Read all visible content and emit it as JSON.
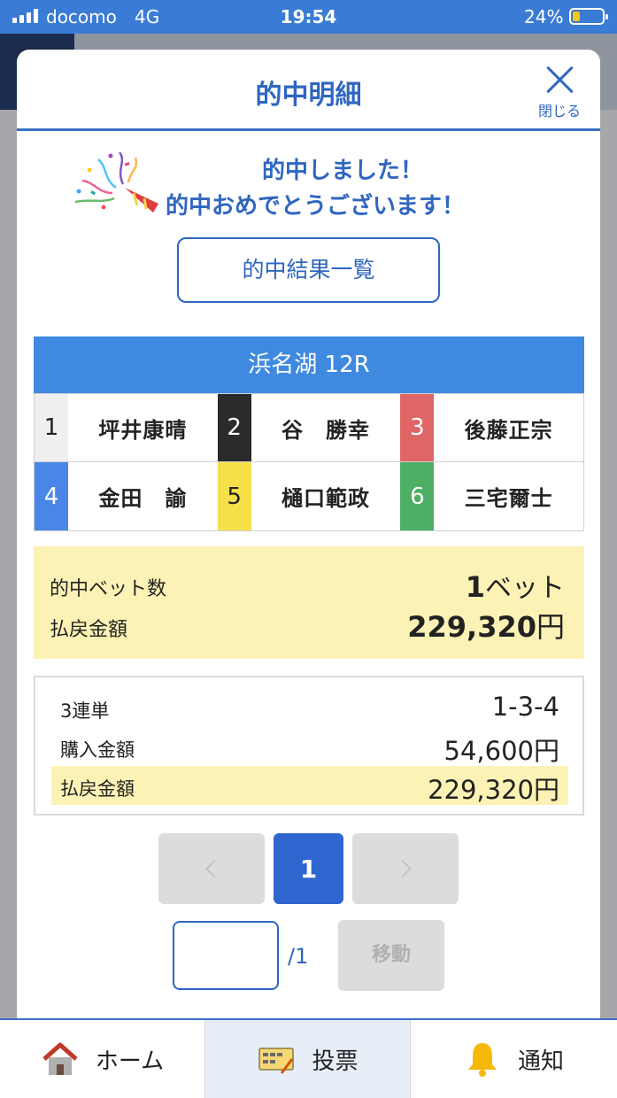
{
  "status_bar": {
    "carrier": "docomo",
    "network": "4G",
    "time": "19:54",
    "battery_percent": "24%"
  },
  "modal": {
    "title": "的中明細",
    "close_label": "閉じる",
    "congrats_line1": "的中しました！",
    "congrats_line2": "的中おめでとうございます！",
    "results_list_button": "的中結果一覧"
  },
  "race": {
    "header": "浜名湖 12R",
    "racers": [
      {
        "number": "1",
        "name": "坪井康晴",
        "color": "#efefef",
        "text_color": "#222222"
      },
      {
        "number": "2",
        "name": "谷　勝幸",
        "color": "#2b2b2b",
        "text_color": "#ffffff"
      },
      {
        "number": "3",
        "name": "後藤正宗",
        "color": "#e06666",
        "text_color": "#ffffff"
      },
      {
        "number": "4",
        "name": "金田　諭",
        "color": "#4a86e8",
        "text_color": "#ffffff"
      },
      {
        "number": "5",
        "name": "樋口範政",
        "color": "#f5e04a",
        "text_color": "#222222"
      },
      {
        "number": "6",
        "name": "三宅爾士",
        "color": "#4caf63",
        "text_color": "#ffffff"
      }
    ]
  },
  "summary": {
    "hit_bets_label": "的中ベット数",
    "hit_bets_count": "1",
    "hit_bets_unit": "ベット",
    "payout_label": "払戻金額",
    "payout_amount": "229,320",
    "payout_unit": "円"
  },
  "bet_detail": {
    "bet_type": "3連単",
    "combination": "1-3-4",
    "purchase_label": "購入金額",
    "purchase_amount": "54,600円",
    "payout_label": "払戻金額",
    "payout_amount": "229,320円"
  },
  "pager": {
    "current_page": "1",
    "total_pages_label": "/1",
    "page_input_value": "",
    "move_button": "移動"
  },
  "bottom_nav": {
    "home": "ホーム",
    "vote": "投票",
    "notify": "通知"
  },
  "colors": {
    "accent": "#2f66c0",
    "race_header": "#3f8ae0",
    "highlight": "#fcf2b5"
  }
}
